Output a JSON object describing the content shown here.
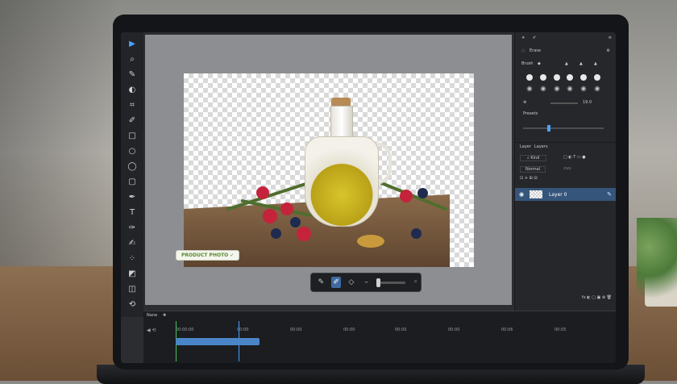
{
  "canvas": {
    "badge_label": "PRODUCT PHOTO ✓"
  },
  "right_panel": {
    "brush_section": "Erase",
    "brushes_label": "Brush",
    "size_value": "19.0",
    "preset_label": "Presets",
    "layers_tabs": [
      "Layer",
      "Layers"
    ],
    "blend_mode": "Normal",
    "layer_name": "Layer 0"
  },
  "timeline": {
    "tab_label": "Nane",
    "times": [
      "00:00:00",
      "00:00",
      "00:00",
      "00:00",
      "00:00",
      "00:00",
      "00:06",
      "00:05"
    ]
  },
  "colors": {
    "accent": "#4aa3ff",
    "selected_layer": "#35557a",
    "clip": "#4a86c7"
  }
}
